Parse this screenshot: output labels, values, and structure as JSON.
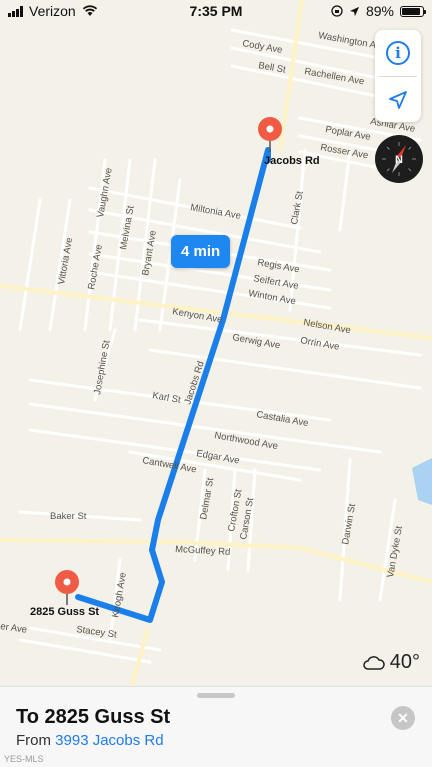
{
  "status_bar": {
    "carrier": "Verizon",
    "time": "7:35 PM",
    "battery_percent": "89%",
    "battery_level": 0.89,
    "icons": [
      "signal-bars-icon",
      "wifi-icon",
      "lock-rotation-icon",
      "location-arrow-icon",
      "battery-icon"
    ]
  },
  "map": {
    "streets": {
      "washington": "Washington Ave",
      "cody": "Cody Ave",
      "bell": "Bell St",
      "rachellen": "Rachellen Ave",
      "ashiar": "Ashiar Ave",
      "poplar": "Poplar Ave",
      "rosser": "Rosser Ave",
      "clark": "Clark St",
      "vaughn": "Vaughn Ave",
      "melvina": "Melvina St",
      "miltonia": "Miltonia Ave",
      "vittoria": "Vittoria Ave",
      "roche": "Roche Ave",
      "bryant": "Bryant Ave",
      "regis": "Regis Ave",
      "seifert": "Seifert Ave",
      "winton": "Winton Ave",
      "kenyon": "Kenyon Ave",
      "nelson": "Nelson Ave",
      "gerwig": "Gerwig Ave",
      "orrin": "Orrin Ave",
      "josephine": "Josephine St",
      "jacobs": "Jacobs Rd",
      "karl": "Karl St",
      "castalia": "Castalia Ave",
      "northwood": "Northwood Ave",
      "edgar": "Edgar Ave",
      "cantwell": "Cantwell Ave",
      "delmar": "Delmar St",
      "crofton": "Crofton St",
      "carson": "Carson St",
      "darwin": "Darwin St",
      "vandyke": "Van Dyke St",
      "baker": "Baker St",
      "mcguffey": "McGuffey Rd",
      "keogh": "Keogh Ave",
      "stacey": "Stacey St",
      "ver": "er Ave"
    },
    "origin_pin_label": "Jacobs Rd",
    "destination_pin_label": "2825 Guss St",
    "route_color": "#1e88f0",
    "eta": "4 min",
    "weather_icon": "cloud-icon",
    "temperature": "40°"
  },
  "controls": {
    "info_icon": "i",
    "location_icon": "location-arrow-icon",
    "compass_heading": "N"
  },
  "card": {
    "title": "To 2825 Guss St",
    "from_prefix": "From",
    "from_address": "3993 Jacobs Rd",
    "close_icon": "✕"
  },
  "watermark": "YES-MLS"
}
